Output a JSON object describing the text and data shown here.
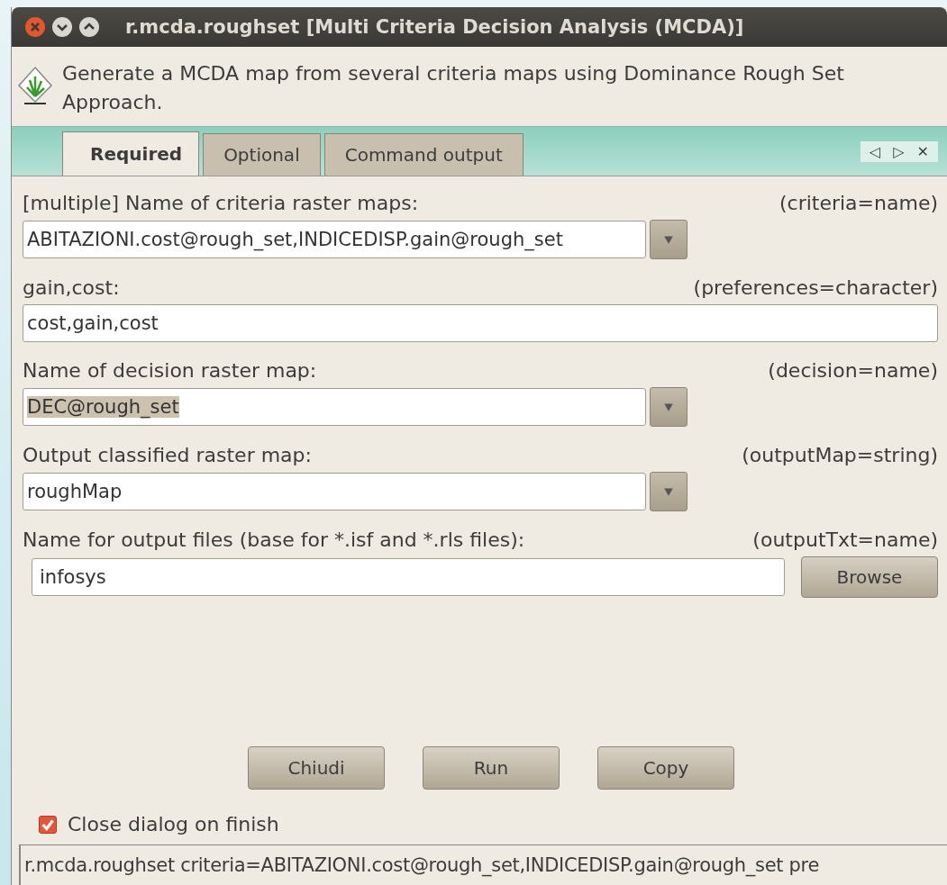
{
  "window": {
    "title": "r.mcda.roughset [Multi Criteria Decision Analysis (MCDA)]"
  },
  "description": "Generate a MCDA map from several criteria maps using Dominance Rough Set Approach.",
  "tabs": [
    {
      "label": "Required",
      "selected": true
    },
    {
      "label": "Optional",
      "selected": false
    },
    {
      "label": "Command output",
      "selected": false
    }
  ],
  "tab_controls": [
    "◁",
    "▷",
    "✕"
  ],
  "fields": [
    {
      "kind": "combo",
      "label": "[multiple] Name of criteria raster maps:",
      "key": "(criteria=name)",
      "value": "ABITAZIONI.cost@rough_set,INDICEDISP.gain@rough_set",
      "highlighted": false
    },
    {
      "kind": "text",
      "label": "gain,cost:",
      "key": "(preferences=character)",
      "value": "cost,gain,cost",
      "highlighted": false
    },
    {
      "kind": "combo",
      "label": "Name of decision raster map:",
      "key": "(decision=name)",
      "value": "DEC@rough_set",
      "highlighted": true
    },
    {
      "kind": "combo",
      "label": "Output classified raster map:",
      "key": "(outputMap=string)",
      "value": "roughMap",
      "highlighted": false
    },
    {
      "kind": "file",
      "label": "Name for output files (base for *.isf and *.rls files):",
      "key": "(outputTxt=name)",
      "value": "infosys",
      "button": "Browse",
      "highlighted": false
    }
  ],
  "buttons": [
    "Chiudi",
    "Run",
    "Copy"
  ],
  "close_on_finish": {
    "label": "Close dialog on finish",
    "checked": true
  },
  "status_bar": "r.mcda.roughset criteria=ABITAZIONI.cost@rough_set,INDICEDISP.gain@rough_set pre"
}
